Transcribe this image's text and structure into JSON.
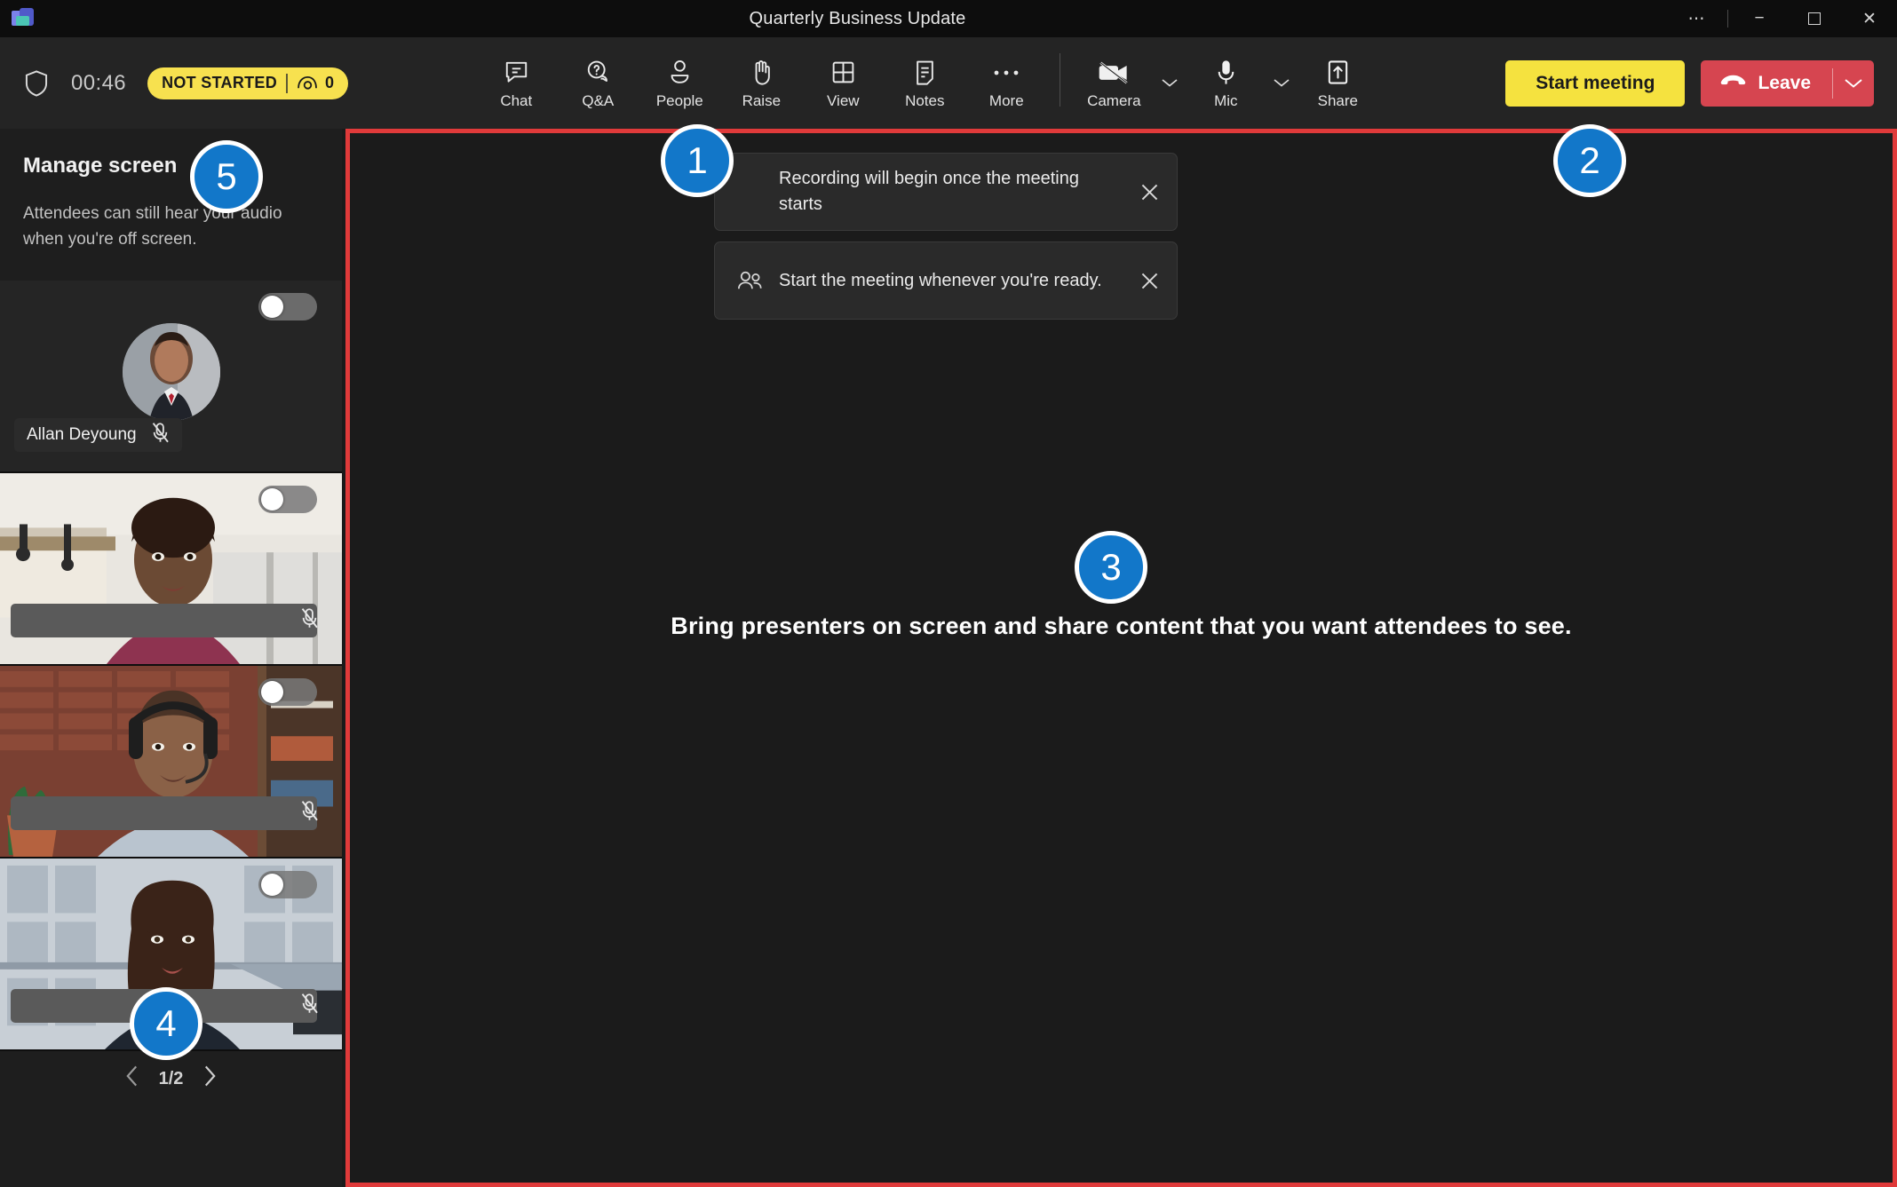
{
  "window": {
    "title": "Quarterly Business Update",
    "controls": {
      "more": "⋯",
      "minimize": "−",
      "maximize": "",
      "close": "✕"
    },
    "logo_icon": "teams-logo-icon"
  },
  "status_bar": {
    "shield_icon": "shield-icon",
    "timer": "00:46",
    "badge": {
      "state_label": "NOT STARTED",
      "attendee_icon": "attendee-eye-icon",
      "attendee_count": "0",
      "background_color": "#f7e14f",
      "text_color": "#1a1a1a"
    }
  },
  "toolbar": {
    "tools": [
      {
        "label": "Chat",
        "icon": "chat-bubble-icon"
      },
      {
        "label": "Q&A",
        "icon": "qa-bubble-icon"
      },
      {
        "label": "People",
        "icon": "person-icon"
      },
      {
        "label": "Raise",
        "icon": "raise-hand-icon"
      },
      {
        "label": "View",
        "icon": "grid-view-icon"
      },
      {
        "label": "Notes",
        "icon": "notes-icon"
      },
      {
        "label": "More",
        "icon": "more-horizontal-icon"
      }
    ],
    "device_tools": [
      {
        "label": "Camera",
        "icon": "camera-off-icon",
        "has_chevron": true
      },
      {
        "label": "Mic",
        "icon": "microphone-icon",
        "has_chevron": true
      },
      {
        "label": "Share",
        "icon": "share-up-arrow-icon",
        "has_chevron": false
      }
    ],
    "start_meeting_label": "Start meeting",
    "start_meeting_color": "#f5e23f",
    "leave_label": "Leave",
    "leave_color": "#d64550",
    "leave_icon": "hangup-phone-icon",
    "leave_chevron_icon": "chevron-down-icon"
  },
  "sidebar": {
    "title": "Manage screen",
    "subtitle": "Attendees can still hear your audio when you're off screen.",
    "tiles": [
      {
        "name": "Allan Deyoung",
        "name_redacted": false,
        "toggle_on": false,
        "muted": true,
        "mic_icon": "mic-off-icon",
        "kind": "avatar"
      },
      {
        "name": "",
        "name_redacted": true,
        "toggle_on": false,
        "muted": true,
        "mic_icon": "mic-off-icon",
        "kind": "video"
      },
      {
        "name": "",
        "name_redacted": true,
        "toggle_on": false,
        "muted": true,
        "mic_icon": "mic-off-icon",
        "kind": "video"
      },
      {
        "name": "",
        "name_redacted": true,
        "toggle_on": false,
        "muted": true,
        "mic_icon": "mic-off-icon",
        "kind": "video"
      }
    ],
    "pager": {
      "prev_icon": "chevron-left-icon",
      "next_icon": "chevron-right-icon",
      "page_label": "1/2"
    }
  },
  "stage": {
    "border_color": "#e03a3a",
    "message": "Bring presenters on screen and share content that you want attendees to see.",
    "toasts": [
      {
        "icon": "",
        "text": "Recording will begin once the meeting starts",
        "close_icon": "close-icon",
        "has_icon": false
      },
      {
        "icon": "people-icon",
        "text": "Start the meeting whenever you're ready.",
        "close_icon": "close-icon",
        "has_icon": true
      }
    ]
  },
  "callouts": [
    {
      "number": "1"
    },
    {
      "number": "2"
    },
    {
      "number": "3"
    },
    {
      "number": "4"
    },
    {
      "number": "5"
    }
  ]
}
